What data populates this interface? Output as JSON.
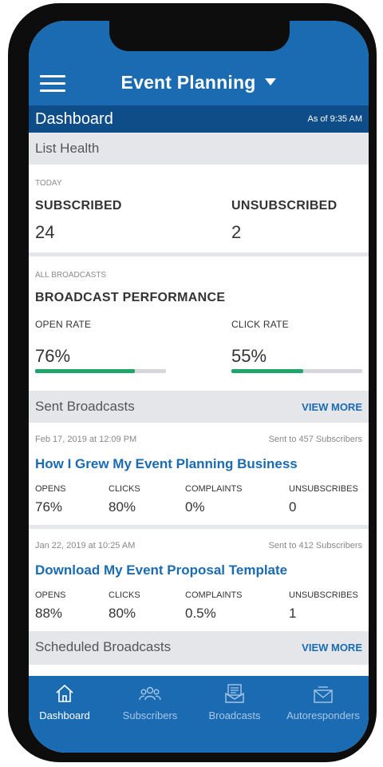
{
  "app": {
    "title": "Event Planning",
    "dashboard_title": "Dashboard",
    "as_of": "As of 9:35 AM"
  },
  "list_health": {
    "section_title": "List Health",
    "period": "TODAY",
    "subscribed_label": "SUBSCRIBED",
    "subscribed_value": "24",
    "unsubscribed_label": "UNSUBSCRIBED",
    "unsubscribed_value": "2"
  },
  "broadcast_performance": {
    "scope": "ALL BROADCASTS",
    "title": "BROADCAST PERFORMANCE",
    "open_rate_label": "OPEN RATE",
    "open_rate_value": "76%",
    "open_rate_fraction": 0.76,
    "click_rate_label": "CLICK RATE",
    "click_rate_value": "55%",
    "click_rate_fraction": 0.55
  },
  "sent_broadcasts": {
    "section_title": "Sent Broadcasts",
    "view_more": "VIEW MORE",
    "items": [
      {
        "date": "Feb 17, 2019 at 12:09 PM",
        "sent_to": "Sent to 457 Subscribers",
        "title": "How I Grew My Event Planning Business",
        "opens_label": "OPENS",
        "opens": "76%",
        "clicks_label": "CLICKS",
        "clicks": "80%",
        "complaints_label": "COMPLAINTS",
        "complaints": "0%",
        "unsubscribes_label": "UNSUBSCRIBES",
        "unsubscribes": "0"
      },
      {
        "date": "Jan 22, 2019 at 10:25 AM",
        "sent_to": "Sent to 412 Subscribers",
        "title": "Download My Event Proposal Template",
        "opens_label": "OPENS",
        "opens": "88%",
        "clicks_label": "CLICKS",
        "clicks": "80%",
        "complaints_label": "COMPLAINTS",
        "complaints": "0.5%",
        "unsubscribes_label": "UNSUBSCRIBES",
        "unsubscribes": "1"
      }
    ]
  },
  "scheduled_broadcasts": {
    "section_title": "Scheduled Broadcasts",
    "view_more": "VIEW MORE"
  },
  "tabs": [
    {
      "label": "Dashboard",
      "icon": "home-icon",
      "active": true
    },
    {
      "label": "Subscribers",
      "icon": "people-icon",
      "active": false
    },
    {
      "label": "Broadcasts",
      "icon": "broadcast-icon",
      "active": false
    },
    {
      "label": "Autoresponders",
      "icon": "envelope-icon",
      "active": false
    }
  ],
  "colors": {
    "primary": "#1a6bb2",
    "header_dark": "#0f4d88",
    "progress": "#1fa46a",
    "section_bg": "#e4e6ea"
  }
}
